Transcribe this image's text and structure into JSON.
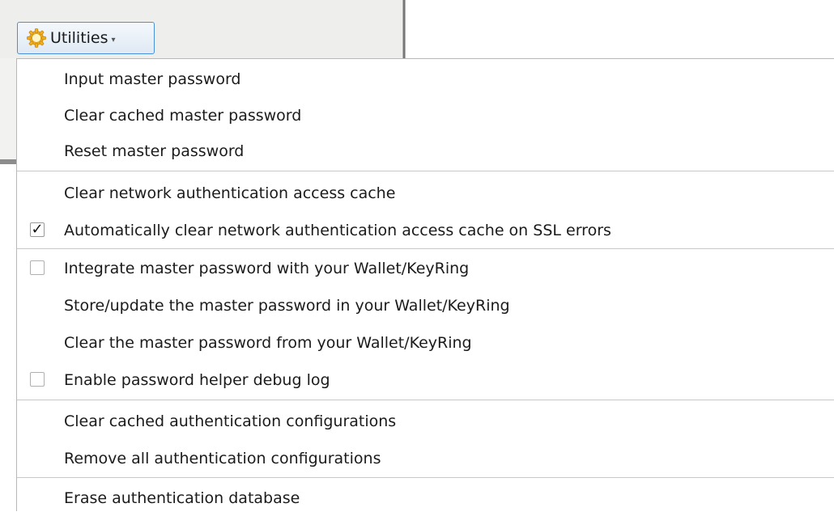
{
  "toolbar": {
    "button_label": "Utilities",
    "button_icon": "gear-icon",
    "caret_icon": "chevron-down-icon",
    "accent_color": "#4a90d9"
  },
  "menu": {
    "items": [
      {
        "label": "Input master password"
      },
      {
        "label": "Clear cached master password"
      },
      {
        "label": "Reset master password"
      },
      {
        "label": "Clear network authentication access cache"
      },
      {
        "label": "Automatically clear network authentication access cache on SSL errors",
        "checkable": true,
        "checked": true,
        "check_mark": "✓"
      },
      {
        "label": "Integrate master password with your Wallet/KeyRing",
        "checkable": true,
        "checked": false
      },
      {
        "label": "Store/update the master password in your Wallet/KeyRing"
      },
      {
        "label": "Clear the master password from your Wallet/KeyRing"
      },
      {
        "label": "Enable password helper debug log",
        "checkable": true,
        "checked": false
      },
      {
        "label": "Clear cached authentication configurations"
      },
      {
        "label": "Remove all authentication configurations"
      },
      {
        "label": "Erase authentication database"
      }
    ]
  }
}
